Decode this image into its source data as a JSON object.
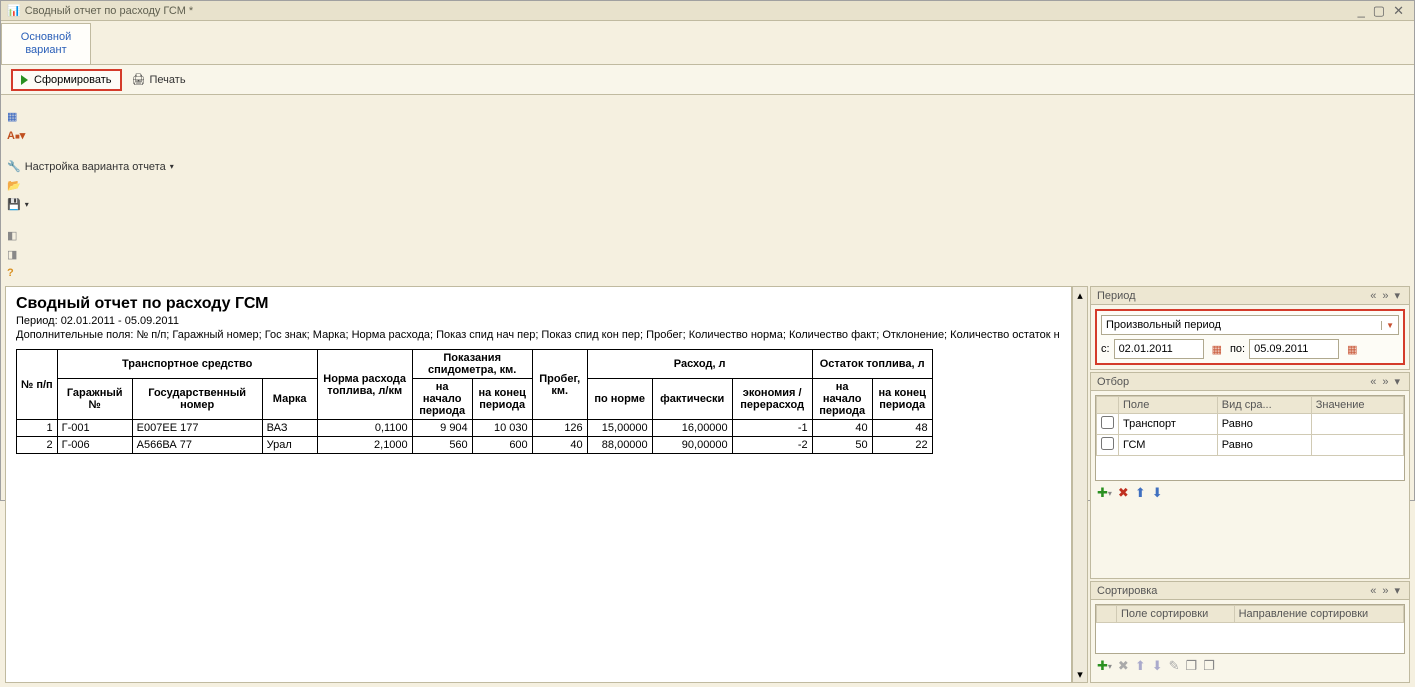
{
  "window": {
    "title": "Сводный отчет по расходу ГСМ *"
  },
  "tab": {
    "main": "Основной вариант"
  },
  "toolbar": {
    "generate": "Сформировать",
    "print": "Печать",
    "settings": "Настройка варианта отчета"
  },
  "report": {
    "title": "Сводный отчет по расходу ГСМ",
    "period_line": "Период: 02.01.2011 - 05.09.2011",
    "extra_line": "Дополнительные поля: № п/п; Гаражный номер; Гос знак; Марка; Норма расхода; Показ спид нач пер; Показ спид кон пер; Пробег; Количество норма; Количество факт; Отклонение; Количество остаток н"
  },
  "headers": {
    "npp": "№ п/п",
    "vehicle": "Транспортное средство",
    "garage": "Гаражный №",
    "state": "Государственный номер",
    "brand": "Марка",
    "norm": "Норма расхода топлива, л/км",
    "odometer": "Показания спидометра, км.",
    "odo_start": "на начало периода",
    "odo_end": "на конец периода",
    "mileage": "Пробег, км.",
    "consumption": "Расход, л",
    "by_norm": "по норме",
    "actual": "фактически",
    "econ": "экономия / перерасход",
    "remainder": "Остаток топлива, л",
    "rem_start": "на начало периода",
    "rem_end": "на конец периода"
  },
  "rows": [
    {
      "n": "1",
      "garage": "Г-001",
      "state": "Е007ЕЕ 177",
      "brand": "ВАЗ",
      "norm": "0,1100",
      "odo_s": "9 904",
      "odo_e": "10 030",
      "mileage": "126",
      "cons_norm": "15,00000",
      "cons_fact": "16,00000",
      "econ": "-1",
      "rem_s": "40",
      "rem_e": "48"
    },
    {
      "n": "2",
      "garage": "Г-006",
      "state": "А566ВА 77",
      "brand": "Урал",
      "norm": "2,1000",
      "odo_s": "560",
      "odo_e": "600",
      "mileage": "40",
      "cons_norm": "88,00000",
      "cons_fact": "90,00000",
      "econ": "-2",
      "rem_s": "50",
      "rem_e": "22"
    }
  ],
  "side": {
    "period_title": "Период",
    "period_type": "Произвольный период",
    "from_label": "с:",
    "from_value": "02.01.2011",
    "to_label": "по:",
    "to_value": "05.09.2011",
    "filter_title": "Отбор",
    "filter_cols": {
      "field": "Поле",
      "comp": "Вид сра...",
      "value": "Значение"
    },
    "filters": [
      {
        "checked": false,
        "field": "Транспорт",
        "comp": "Равно",
        "value": ""
      },
      {
        "checked": false,
        "field": "ГСМ",
        "comp": "Равно",
        "value": ""
      }
    ],
    "sort_title": "Сортировка",
    "sort_cols": {
      "field": "Поле сортировки",
      "dir": "Направление сортировки"
    }
  }
}
